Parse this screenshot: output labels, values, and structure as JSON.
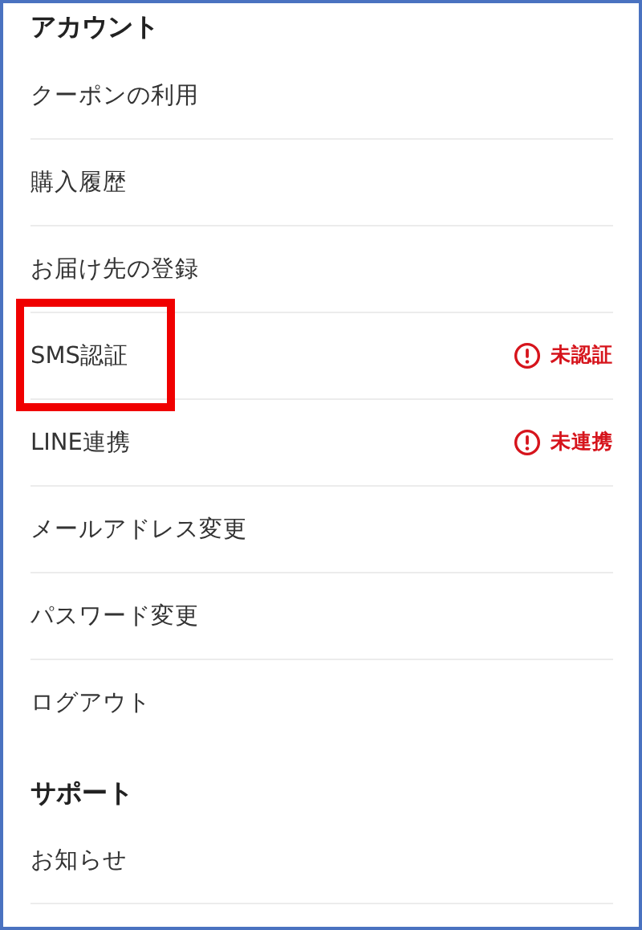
{
  "sections": [
    {
      "title": "アカウント",
      "items": [
        {
          "label": "クーポンの利用",
          "divider": true,
          "highlighted": false
        },
        {
          "label": "購入履歴",
          "divider": true,
          "highlighted": false
        },
        {
          "label": "お届け先の登録",
          "divider": true,
          "highlighted": false
        },
        {
          "label": "SMS認証",
          "divider": true,
          "highlighted": true,
          "status": "未認証"
        },
        {
          "label": "LINE連携",
          "divider": true,
          "highlighted": false,
          "status": "未連携"
        },
        {
          "label": "メールアドレス変更",
          "divider": true,
          "highlighted": false
        },
        {
          "label": "パスワード変更",
          "divider": true,
          "highlighted": false
        },
        {
          "label": "ログアウト",
          "divider": false,
          "highlighted": false
        }
      ]
    },
    {
      "title": "サポート",
      "items": [
        {
          "label": "お知らせ",
          "divider": true,
          "highlighted": false
        }
      ]
    }
  ]
}
